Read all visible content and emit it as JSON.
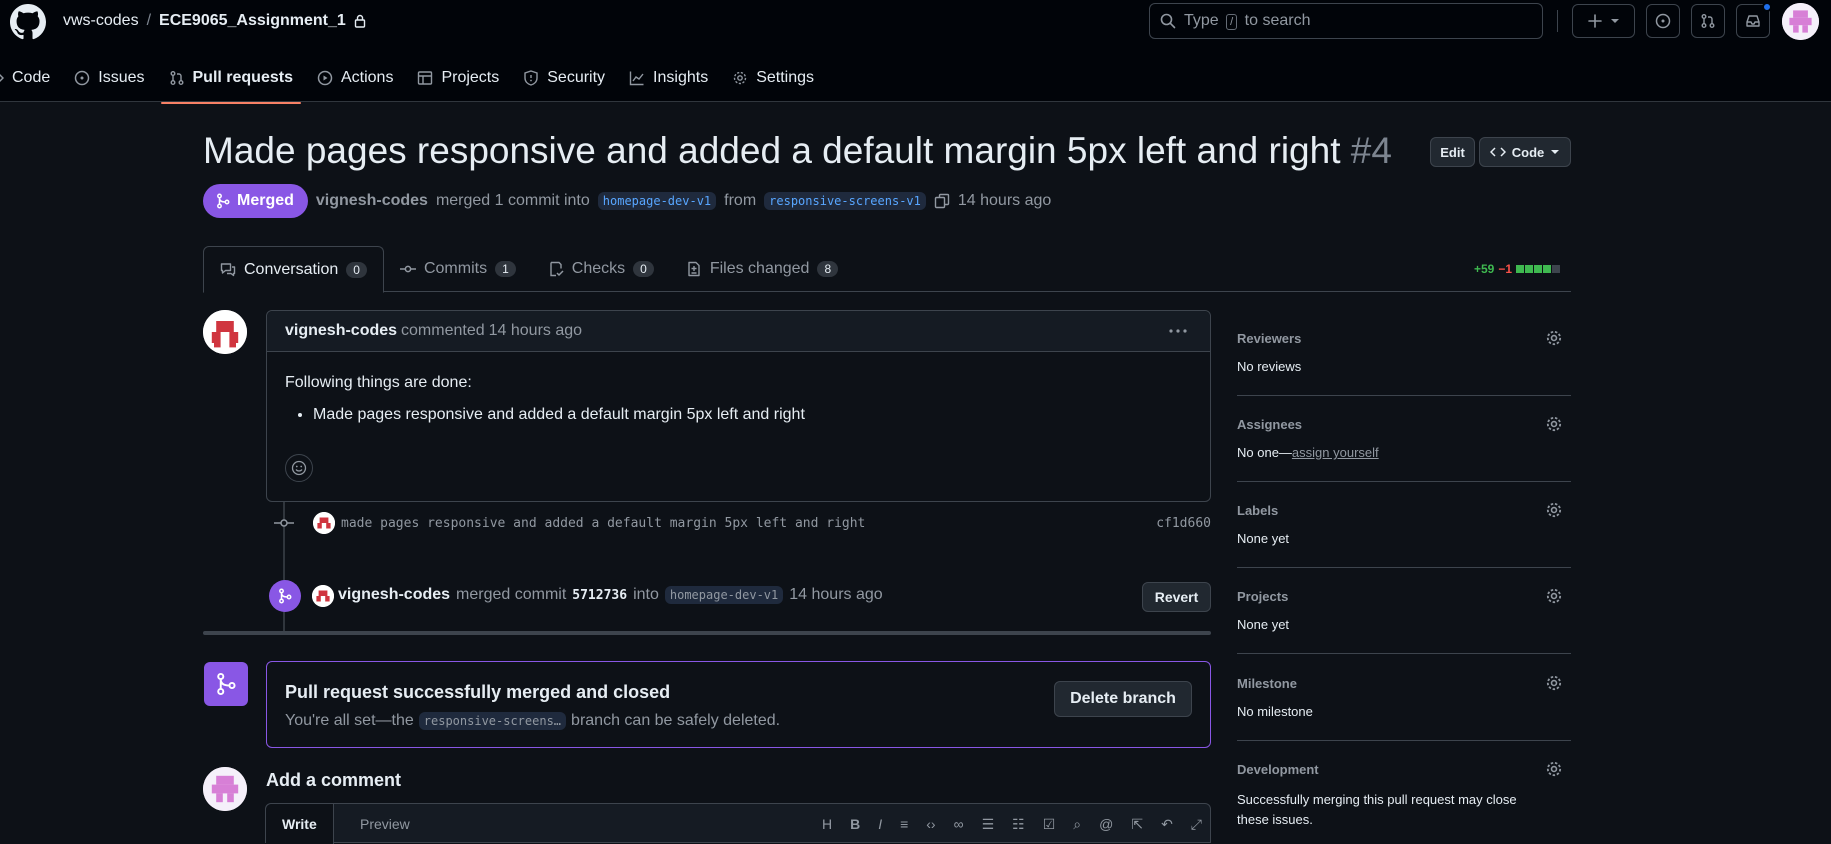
{
  "header": {
    "owner": "vws-codes",
    "separator": "/",
    "repo": "ECE9065_Assignment_1",
    "search_prefix": "Type",
    "search_key": "/",
    "search_suffix": "to search"
  },
  "reponav": {
    "tabs": [
      {
        "label": "Code"
      },
      {
        "label": "Issues"
      },
      {
        "label": "Pull requests"
      },
      {
        "label": "Actions"
      },
      {
        "label": "Projects"
      },
      {
        "label": "Security"
      },
      {
        "label": "Insights"
      },
      {
        "label": "Settings"
      }
    ],
    "active": "Pull requests"
  },
  "pr": {
    "title": "Made pages responsive and added a default margin 5px left and right",
    "number": "#4",
    "edit_label": "Edit",
    "code_label": "Code",
    "state": "Merged",
    "author": "vignesh-codes",
    "merged_text": "merged 1 commit into",
    "base_branch": "homepage-dev-v1",
    "from_text": "from",
    "head_branch": "responsive-screens-v1",
    "time": "14 hours ago"
  },
  "pr_tabs": [
    {
      "label": "Conversation",
      "count": "0"
    },
    {
      "label": "Commits",
      "count": "1"
    },
    {
      "label": "Checks",
      "count": "0"
    },
    {
      "label": "Files changed",
      "count": "8"
    }
  ],
  "diffstat": {
    "additions": "+59",
    "deletions": "−1"
  },
  "comment": {
    "author": "vignesh-codes",
    "action": "commented",
    "time": "14 hours ago",
    "body_intro": "Following things are done:",
    "body_item": "Made pages responsive and added a default margin 5px left and right"
  },
  "commit": {
    "message": "made pages responsive and added a default margin 5px left and right",
    "sha": "cf1d660"
  },
  "merge_event": {
    "author": "vignesh-codes",
    "text": "merged commit",
    "sha": "5712736",
    "into": "into",
    "branch": "homepage-dev-v1",
    "time": "14 hours ago",
    "revert_label": "Revert"
  },
  "merge_box": {
    "title": "Pull request successfully merged and closed",
    "sub_prefix": "You're all set—the",
    "branch": "responsive-screens…",
    "sub_suffix": "branch can be safely deleted.",
    "delete_label": "Delete branch"
  },
  "add_comment": {
    "title": "Add a comment",
    "write_tab": "Write",
    "preview_tab": "Preview"
  },
  "sidebar": {
    "reviewers": {
      "title": "Reviewers",
      "value": "No reviews"
    },
    "assignees": {
      "title": "Assignees",
      "value": "No one—",
      "link": "assign yourself"
    },
    "labels": {
      "title": "Labels",
      "value": "None yet"
    },
    "projects": {
      "title": "Projects",
      "value": "None yet"
    },
    "milestone": {
      "title": "Milestone",
      "value": "No milestone"
    },
    "development": {
      "title": "Development",
      "value": "Successfully merging this pull request may close these issues."
    }
  },
  "colors": {
    "merged": "#8957e5",
    "accent_tab": "#f78166",
    "added": "#3fb950",
    "deleted": "#f85149",
    "link": "#58a6ff"
  }
}
